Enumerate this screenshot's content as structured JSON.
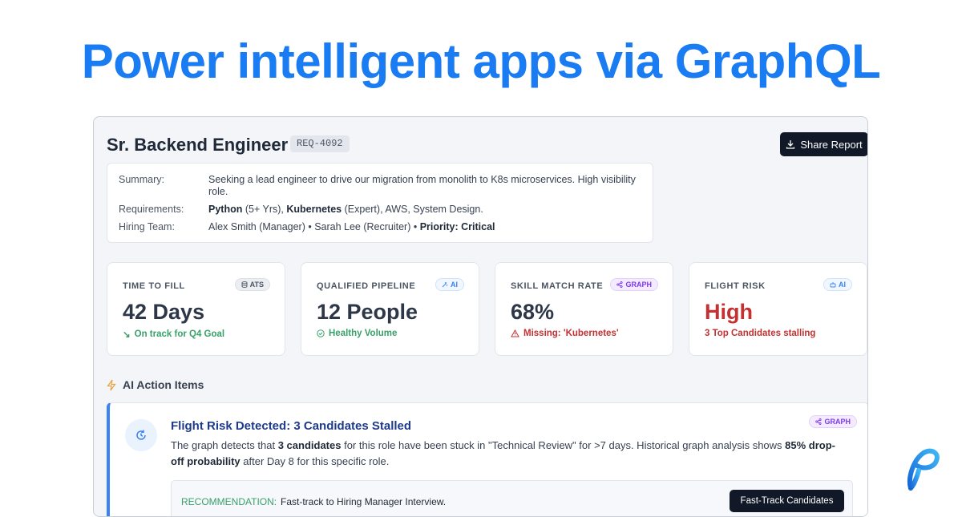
{
  "hero": {
    "title": "Power intelligent apps via GraphQL"
  },
  "job": {
    "title": "Sr. Backend Engineer",
    "req_id": "REQ-4092",
    "share_label": "Share Report"
  },
  "summary": {
    "summary_label": "Summary:",
    "summary_value": "Seeking a lead engineer to drive our migration from monolith to K8s microservices. High visibility role.",
    "requirements_label": "Requirements:",
    "req_python": "Python",
    "req_python_detail": " (5+ Yrs), ",
    "req_k8s": "Kubernetes",
    "req_rest": " (Expert), AWS, System Design.",
    "team_label": "Hiring Team:",
    "team_members": "Alex Smith (Manager) • Sarah Lee (Recruiter) • ",
    "team_priority": "Priority: Critical"
  },
  "metrics": [
    {
      "label": "TIME TO FILL",
      "tag": "ATS",
      "value": "42 Days",
      "sub": "On track for Q4 Goal"
    },
    {
      "label": "QUALIFIED PIPELINE",
      "tag": "AI",
      "value": "12 People",
      "sub": "Healthy Volume"
    },
    {
      "label": "SKILL MATCH RATE",
      "tag": "GRAPH",
      "value": "68%",
      "sub": "Missing: 'Kubernetes'"
    },
    {
      "label": "FLIGHT RISK",
      "tag": "AI",
      "value": "High",
      "sub": "3 Top Candidates stalling"
    }
  ],
  "actions": {
    "section_title": "AI Action Items",
    "title": "Flight Risk Detected: 3 Candidates Stalled",
    "tag": "GRAPH",
    "body_1": "The graph detects that ",
    "body_bold_1": "3 candidates",
    "body_2": " for this role have been stuck in \"Technical Review\" for >7 days. Historical graph analysis shows ",
    "body_bold_2": "85% drop-off probability",
    "body_3": " after Day 8 for this specific role.",
    "rec_label": "RECOMMENDATION:",
    "rec_text": "Fast-track to Hiring Manager Interview.",
    "button": "Fast-Track Candidates"
  },
  "colors": {
    "hero": "#1a7cf2",
    "accent_blue": "#3b82f6",
    "success": "#38a169",
    "danger": "#c53030",
    "graph_purple": "#7c3aed",
    "dark_button": "#111827"
  }
}
